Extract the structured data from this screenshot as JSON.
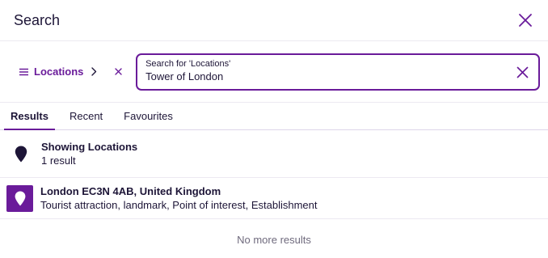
{
  "header": {
    "title": "Search"
  },
  "filter": {
    "label": "Locations"
  },
  "search": {
    "floating_label": "Search for 'Locations'",
    "value": "Tower of London"
  },
  "tabs": [
    {
      "label": "Results",
      "active": true
    },
    {
      "label": "Recent",
      "active": false
    },
    {
      "label": "Favourites",
      "active": false
    }
  ],
  "summary": {
    "title": "Showing Locations",
    "count": "1 result"
  },
  "results": [
    {
      "title": "London EC3N 4AB, United Kingdom",
      "subtitle": "Tourist attraction, landmark, Point of interest, Establishment"
    }
  ],
  "footer": {
    "text": "No more results"
  },
  "colors": {
    "accent": "#6a1b9a",
    "text": "#1d1537",
    "muted": "#6f6a7d"
  },
  "icons": {
    "close": "close-icon",
    "menu": "menu-icon",
    "chevron": "chevron-right-icon",
    "chip_clear": "clear-filter-icon",
    "input_clear": "clear-input-icon",
    "pin": "map-pin-icon"
  }
}
